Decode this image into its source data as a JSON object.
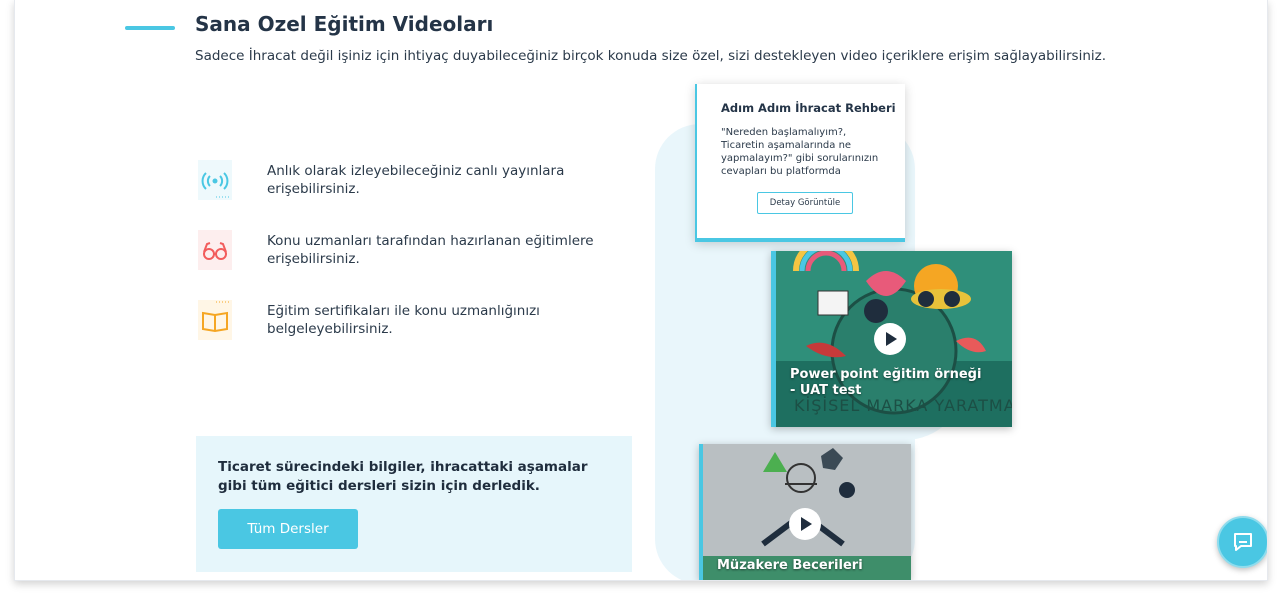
{
  "header": {
    "title": "Sana Ozel Eğitim Videoları",
    "subtitle": "Sadece İhracat değil işiniz için ihtiyaç duyabileceğiniz birçok konuda size özel, sizi destekleyen video içeriklere erişim sağlayabilirsiniz."
  },
  "features": [
    {
      "icon": "live-broadcast-icon",
      "text": "Anlık olarak izleyebileceğiniz canlı yayınlara erişebilirsiniz."
    },
    {
      "icon": "glasses-icon",
      "text": "Konu uzmanları tarafından hazırlanan eğitimlere erişebilirsiniz."
    },
    {
      "icon": "book-icon",
      "text": "Eğitim sertifikaları ile konu uzmanlığınızı belgeleyebilirsiniz."
    }
  ],
  "cta": {
    "text": "Ticaret sürecindeki bilgiler, ihracattaki aşamalar gibi tüm eğitici dersleri sizin için derledik.",
    "button": "Tüm Dersler"
  },
  "guide_card": {
    "title": "Adım Adım İhracat Rehberi",
    "description": "\"Nereden başlamalıyım?, Ticaretin aşamalarında ne yapmalayım?\" gibi sorularınızın cevapları bu platformda",
    "button": "Detay Görüntüle"
  },
  "videos": [
    {
      "title": "Power point eğitim örneği - UAT test",
      "overlay_text": "KİŞİSEL MARKA YARATMA"
    },
    {
      "title": "Müzakere Becerileri"
    }
  ],
  "colors": {
    "accent": "#4ac7e3",
    "light_bg": "#e6f6fb",
    "text": "#243447"
  }
}
